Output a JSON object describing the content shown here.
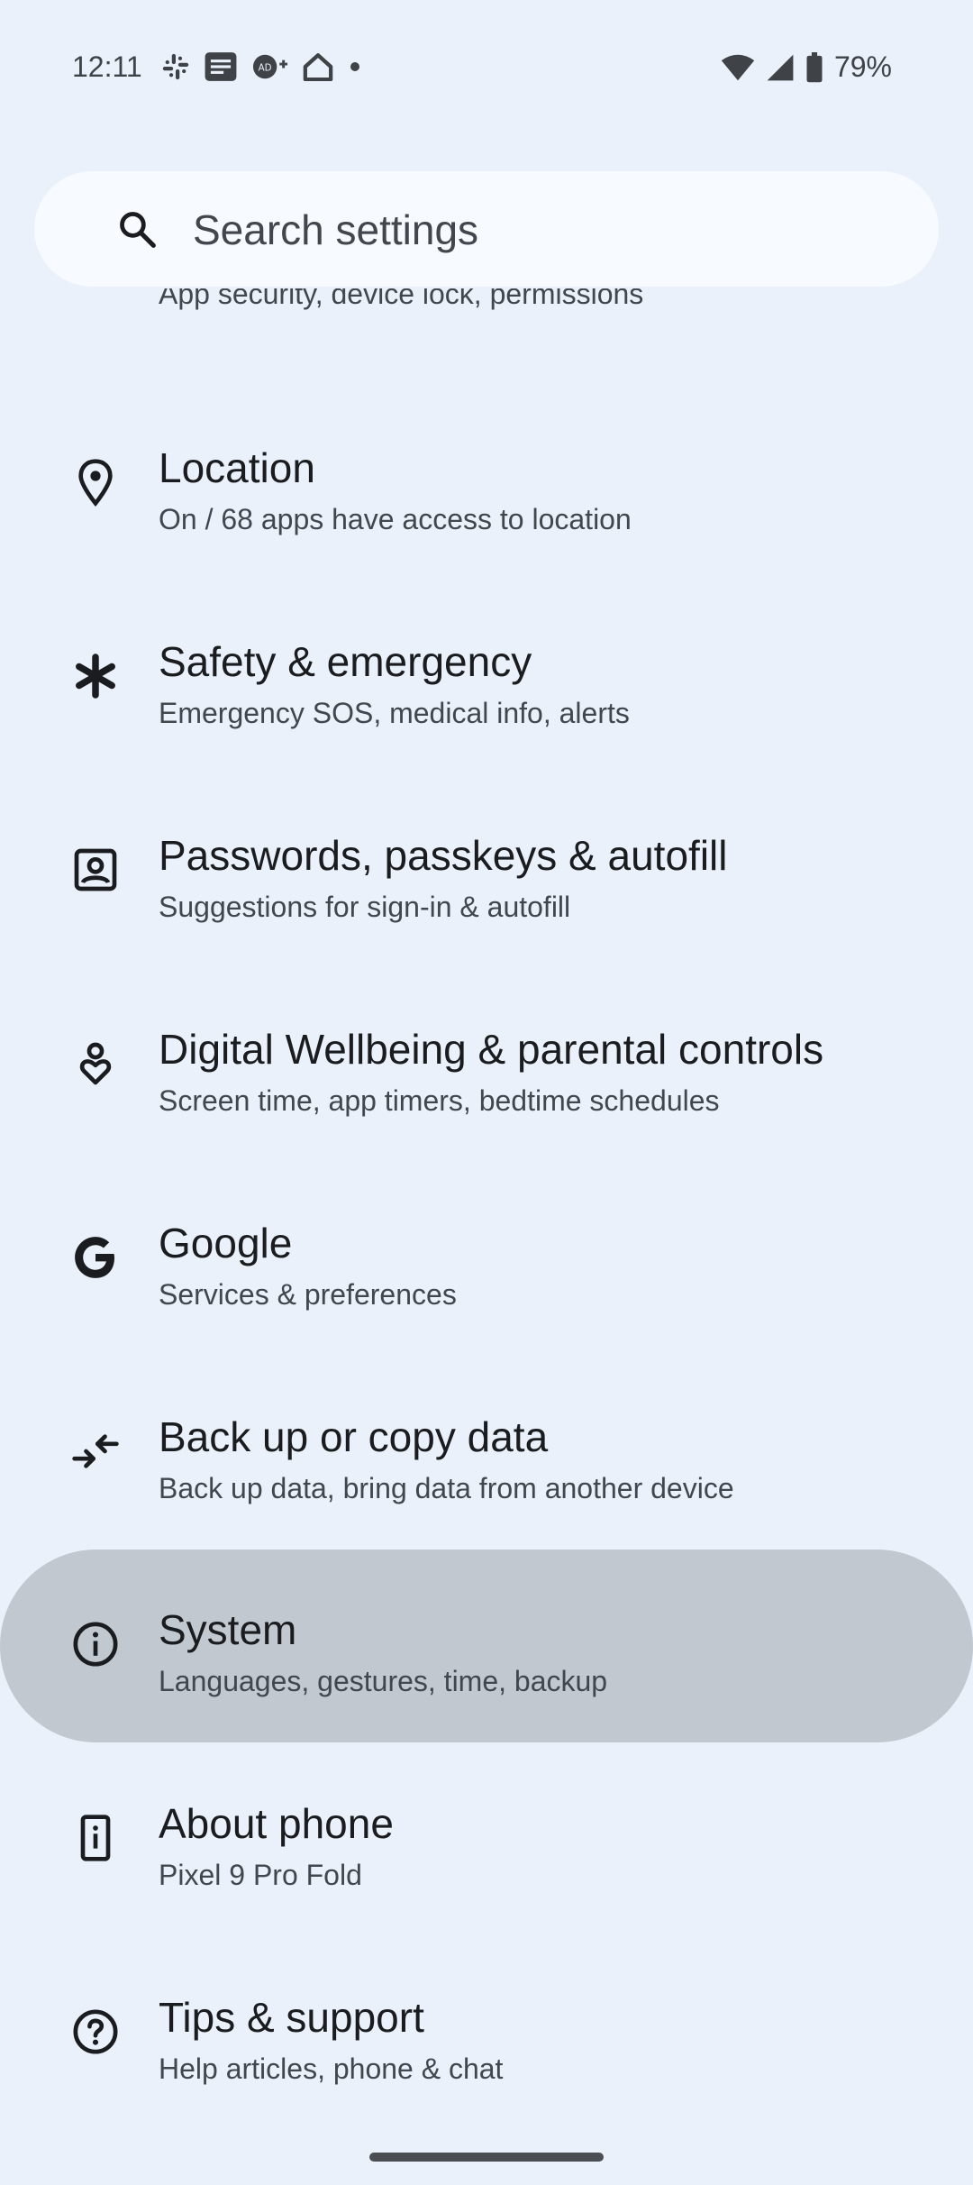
{
  "status_bar": {
    "time": "12:11",
    "left_icons": [
      "slack-icon",
      "message-icon",
      "ad-icon",
      "home-icon",
      "dot-icon"
    ],
    "right_icons": [
      "wifi-icon",
      "signal-icon",
      "battery-icon"
    ],
    "battery_percent": "79%"
  },
  "search": {
    "placeholder": "Search settings"
  },
  "partial_item": {
    "subtitle": "App security, device lock, permissions"
  },
  "items": [
    {
      "icon": "location-pin-icon",
      "title": "Location",
      "subtitle": "On / 68 apps have access to location"
    },
    {
      "icon": "asterisk-icon",
      "title": "Safety & emergency",
      "subtitle": "Emergency SOS, medical info, alerts"
    },
    {
      "icon": "password-icon",
      "title": "Passwords, passkeys & autofill",
      "subtitle": "Suggestions for sign-in & autofill"
    },
    {
      "icon": "wellbeing-icon",
      "title": "Digital Wellbeing & parental controls",
      "subtitle": "Screen time, app timers, bedtime schedules"
    },
    {
      "icon": "google-icon",
      "title": "Google",
      "subtitle": "Services & preferences"
    },
    {
      "icon": "backup-transfer-icon",
      "title": "Back up or copy data",
      "subtitle": "Back up data, bring data from another device"
    },
    {
      "icon": "info-icon",
      "title": "System",
      "subtitle": "Languages, gestures, time, backup"
    },
    {
      "icon": "phone-info-icon",
      "title": "About phone",
      "subtitle": "Pixel 9 Pro Fold"
    },
    {
      "icon": "help-icon",
      "title": "Tips & support",
      "subtitle": "Help articles, phone & chat"
    }
  ],
  "colors": {
    "background": "#eaf1fb",
    "search_bg": "#f7fafe",
    "highlight": "#c2c8d0",
    "text_primary": "#1b1c1f",
    "text_secondary": "#42474e"
  }
}
